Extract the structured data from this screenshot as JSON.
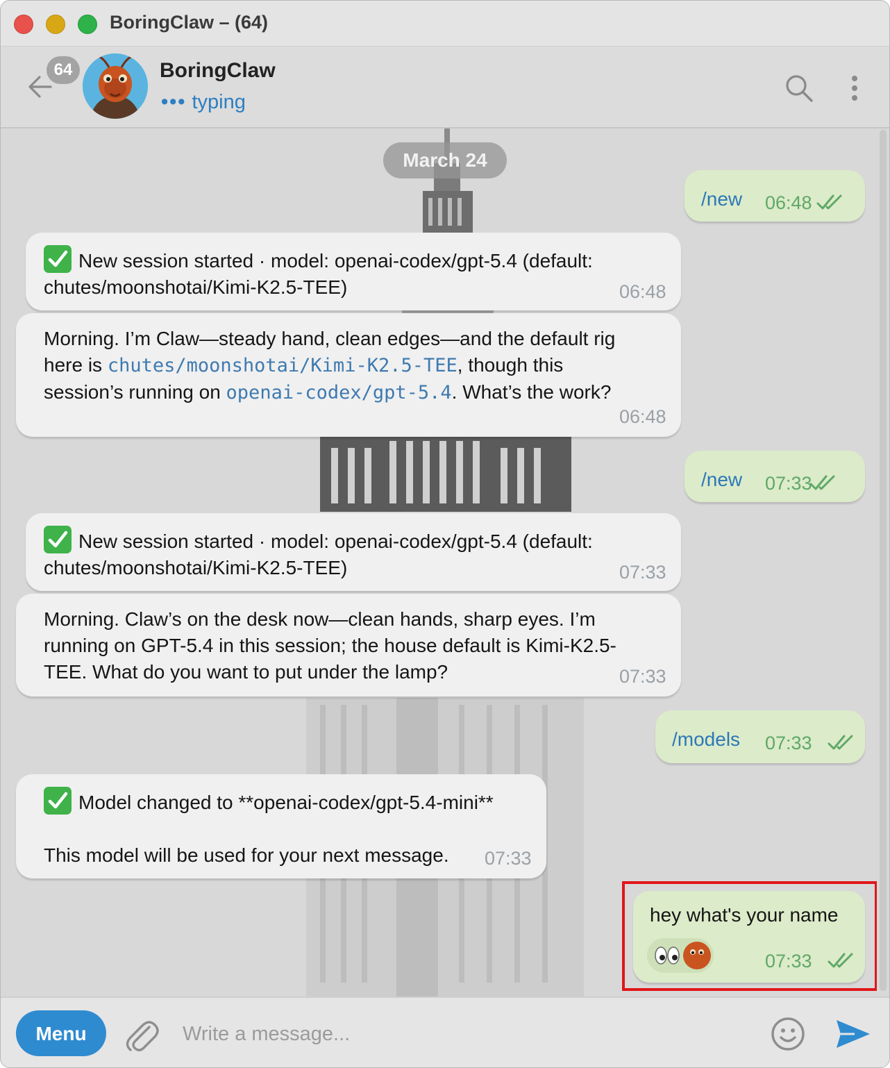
{
  "window": {
    "title": "BoringClaw – (64)"
  },
  "header": {
    "unread_count": "64",
    "name": "BoringClaw",
    "status": "typing",
    "status_dots": "•••"
  },
  "chat": {
    "date_label": "March 24",
    "messages": [
      {
        "dir": "out",
        "text": "/new",
        "time": "06:48"
      },
      {
        "dir": "in",
        "line1": "New session started · model: openai-codex/gpt-5.4 (default:",
        "line2": "chutes/moonshotai/Kimi-K2.5-TEE)",
        "time": "06:48"
      },
      {
        "dir": "in",
        "l1": "Morning. I’m Claw—steady hand, clean edges—and the default rig",
        "l2a": "here is ",
        "l2code": "chutes/moonshotai/Kimi-K2.5-TEE",
        "l2b": ", though this",
        "l3a": "session’s running on ",
        "l3code": "openai-codex/gpt-5.4",
        "l3b": ". What’s the work?",
        "time": "06:48"
      },
      {
        "dir": "out",
        "text": "/new",
        "time": "07:33"
      },
      {
        "dir": "in",
        "line1": "New session started · model: openai-codex/gpt-5.4 (default:",
        "line2": "chutes/moonshotai/Kimi-K2.5-TEE)",
        "time": "07:33"
      },
      {
        "dir": "in",
        "l1": "Morning. Claw’s on the desk now—clean hands, sharp eyes. I’m",
        "l2": "running on GPT-5.4 in this session; the house default is Kimi-K2.5-",
        "l3": "TEE. What do you want to put under the lamp?",
        "time": "07:33"
      },
      {
        "dir": "out",
        "text": "/models",
        "time": "07:33"
      },
      {
        "dir": "in",
        "line1": "Model changed to **openai-codex/gpt-5.4-mini**",
        "line2": "This model will be used for your next message.",
        "time": "07:33"
      },
      {
        "dir": "out",
        "text": "hey what's your name",
        "reaction": "👀",
        "time": "07:33"
      }
    ]
  },
  "composer": {
    "menu_label": "Menu",
    "placeholder": "Write a message..."
  },
  "colors": {
    "accent": "#2f8bd0",
    "outgoing_bubble": "#dcebc9",
    "incoming_bubble": "#f0f0f0",
    "highlight": "#e0161b"
  },
  "icons": [
    "back-arrow-icon",
    "search-icon",
    "more-vertical-icon",
    "attach-icon",
    "emoji-icon",
    "send-icon",
    "check-emoji-icon",
    "double-check-icon",
    "eyes-emoji-icon"
  ]
}
